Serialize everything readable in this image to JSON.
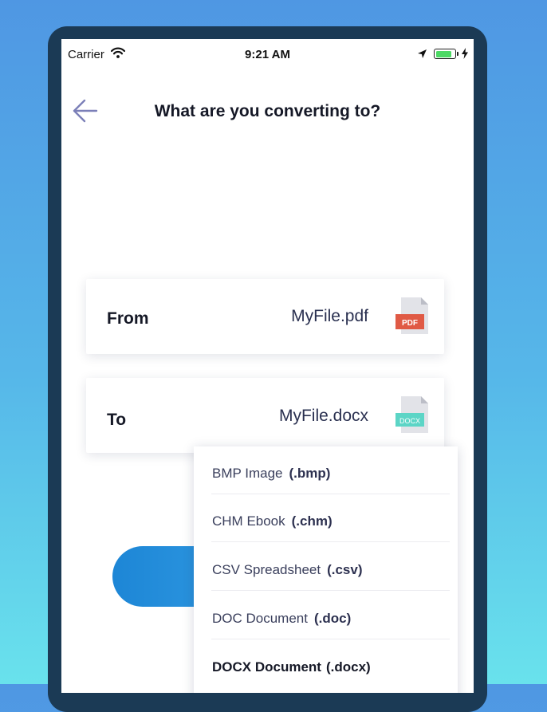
{
  "status_bar": {
    "carrier": "Carrier",
    "time": "9:21 AM"
  },
  "header": {
    "title": "What are you converting to?"
  },
  "from_card": {
    "label": "From",
    "filename": "MyFile.pdf",
    "badge": "PDF",
    "badge_color": "#e05a45"
  },
  "to_card": {
    "label": "To",
    "filename": "MyFile.docx",
    "badge": "DOCX",
    "badge_color": "#5cd5c6"
  },
  "format_options": [
    {
      "name": "BMP Image",
      "ext": "(.bmp)",
      "selected": false
    },
    {
      "name": "CHM Ebook",
      "ext": "(.chm)",
      "selected": false
    },
    {
      "name": "CSV Spreadsheet",
      "ext": "(.csv)",
      "selected": false
    },
    {
      "name": "DOC Document",
      "ext": "(.doc)",
      "selected": false
    },
    {
      "name": "DOCX Document",
      "ext": "(.docx)",
      "selected": true
    }
  ],
  "colors": {
    "background_top": "#4f97e3",
    "background_bottom": "#69e2ec",
    "device_frame": "#1b3a55",
    "button_gradient_start": "#1d86d6",
    "button_gradient_end": "#3aa4e8",
    "back_arrow": "#7b7fb8",
    "battery": "#4cd964"
  },
  "icons": [
    "wifi-icon",
    "location-arrow-icon",
    "battery-icon",
    "charging-bolt-icon",
    "back-arrow-icon",
    "pdf-file-icon",
    "docx-file-icon"
  ]
}
